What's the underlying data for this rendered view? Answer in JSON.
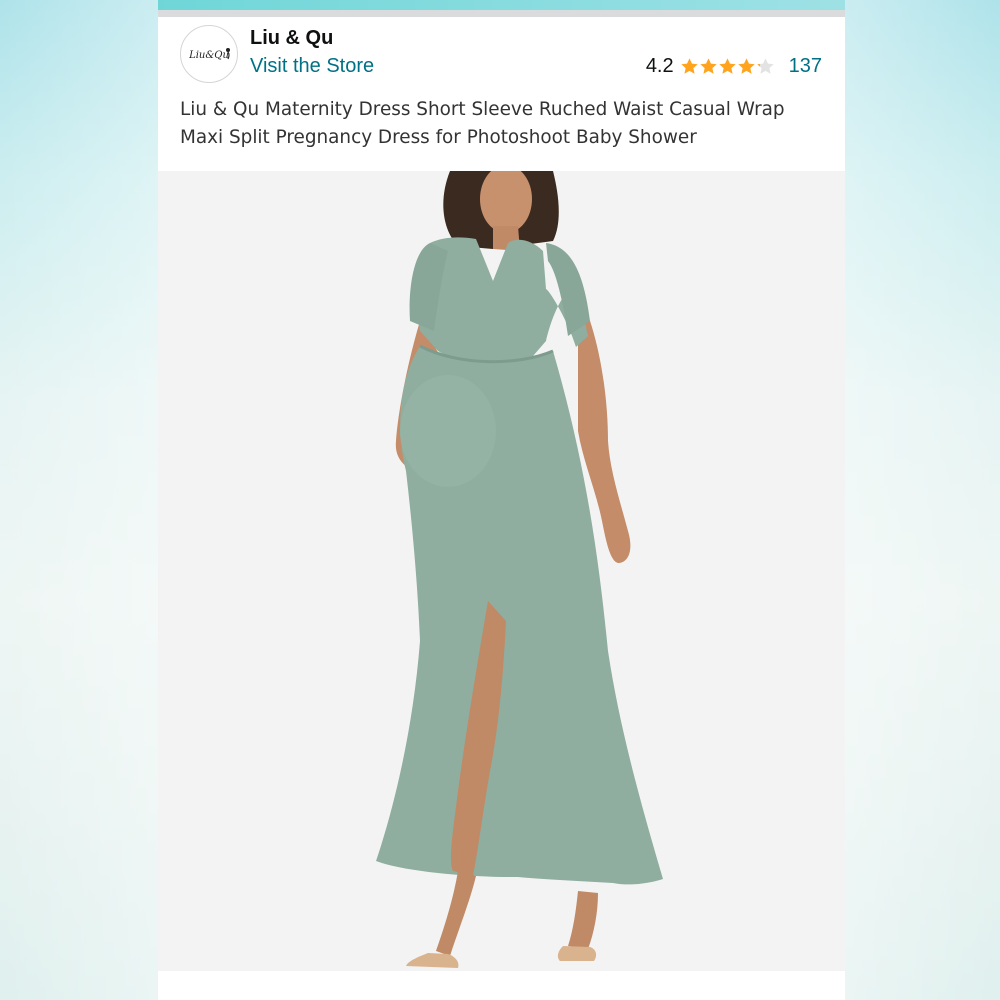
{
  "store": {
    "logo_text": "Liu&Qu",
    "name": "Liu & Qu",
    "visit_label": "Visit the Store"
  },
  "rating": {
    "value": "4.2",
    "stars_filled": 4.2,
    "stars_total": 5,
    "review_count": "137"
  },
  "product": {
    "title": "Liu & Qu Maternity Dress Short Sleeve Ruched Waist Casual Wrap Maxi Split Pregnancy Dress for Photoshoot Baby Shower",
    "image_subject": "maternity-dress-model-photo"
  },
  "colors": {
    "link": "#007185",
    "star": "#ffa41c",
    "dress": "#8fae9f",
    "top_accent": "#6fd6d8"
  },
  "icons": {
    "star": "star-icon"
  }
}
